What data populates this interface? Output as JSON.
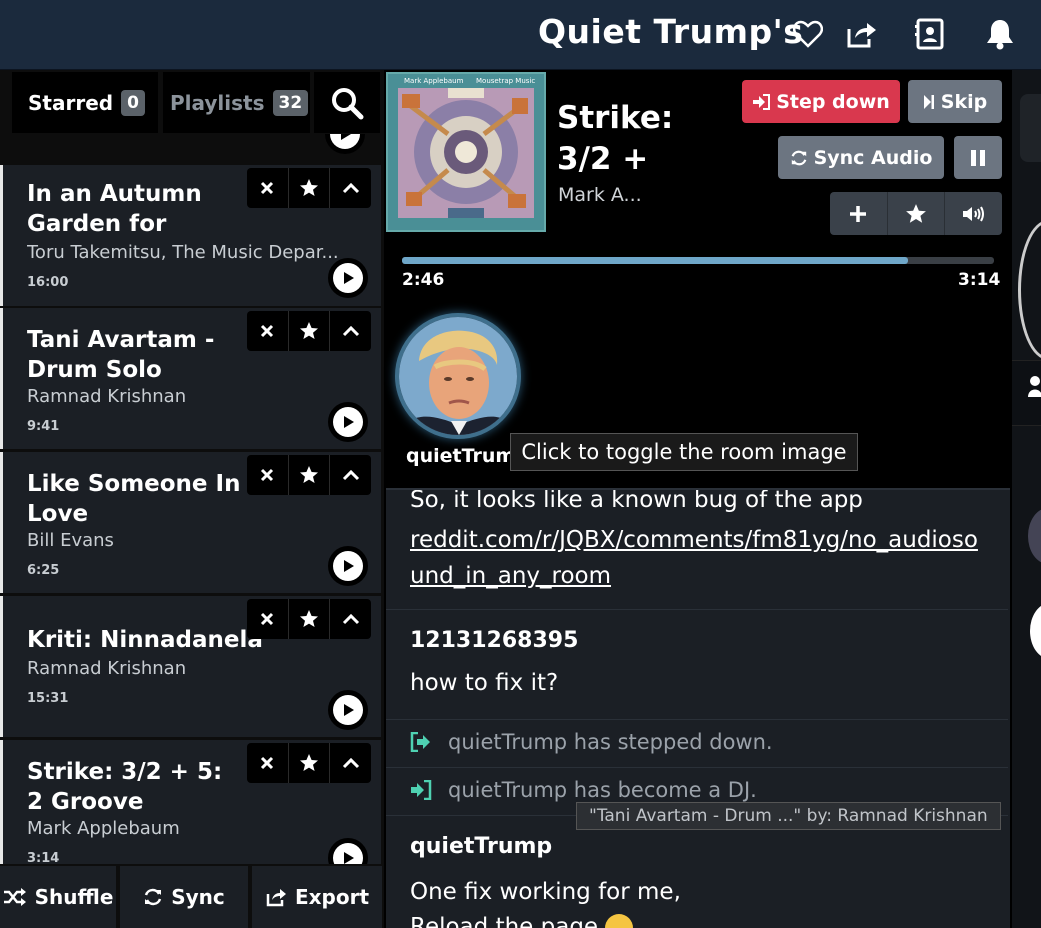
{
  "header": {
    "room_title": "Quiet Trump's"
  },
  "left": {
    "tabs": [
      {
        "label": "Starred",
        "count": "0"
      },
      {
        "label": "Playlists",
        "count": "32"
      }
    ],
    "tracks": [
      {
        "title": "In an Autumn Garden for",
        "artist": "Toru Takemitsu, The Music Depar...",
        "duration": "16:00"
      },
      {
        "title": "Tani Avartam - Drum Solo",
        "artist": "Ramnad Krishnan",
        "duration": "9:41"
      },
      {
        "title": "Like Someone In Love",
        "artist": "Bill Evans",
        "duration": "6:25"
      },
      {
        "title": "Kriti: Ninnadanela",
        "artist": "Ramnad Krishnan",
        "duration": "15:31"
      },
      {
        "title": "Strike: 3/2 + 5: 2 Groove",
        "artist": "Mark Applebaum",
        "duration": "3:14"
      }
    ],
    "bottom": {
      "shuffle": "Shuffle",
      "sync": "Sync",
      "export": "Export"
    }
  },
  "player": {
    "title": "Strike: 3/2 +",
    "artist": "Mark A...",
    "album_text_left": "Mark Applebaum",
    "album_text_right": "Mousetrap Music",
    "step_down": "Step down",
    "skip": "Skip",
    "sync_audio": "Sync Audio",
    "elapsed": "2:46",
    "total": "3:14",
    "progress": 0.855,
    "dj_name": "quietTrump",
    "tooltip": "Click to toggle the room image"
  },
  "chat": {
    "msg1_text": "So, it looks like a known bug of the app",
    "msg1_link": "reddit.com/r/JQBX/comments/fm81yg/no_audioso und_in_any_room",
    "msg2_user": "12131268395",
    "msg2_text": "how to fix it?",
    "sys1": "quietTrump has stepped down.",
    "sys2": "quietTrump has become a DJ.",
    "now_tip": "\"Tani Avartam - Drum ...\" by: Ramnad Krishnan",
    "msg3_user": "quietTrump",
    "msg3_text1": "One fix working for me,",
    "msg3_text2": "Reload the page"
  },
  "colors": {
    "accent_red": "#d9384e",
    "progress": "#6fa7c9",
    "header_bg": "#1b2a3d"
  }
}
